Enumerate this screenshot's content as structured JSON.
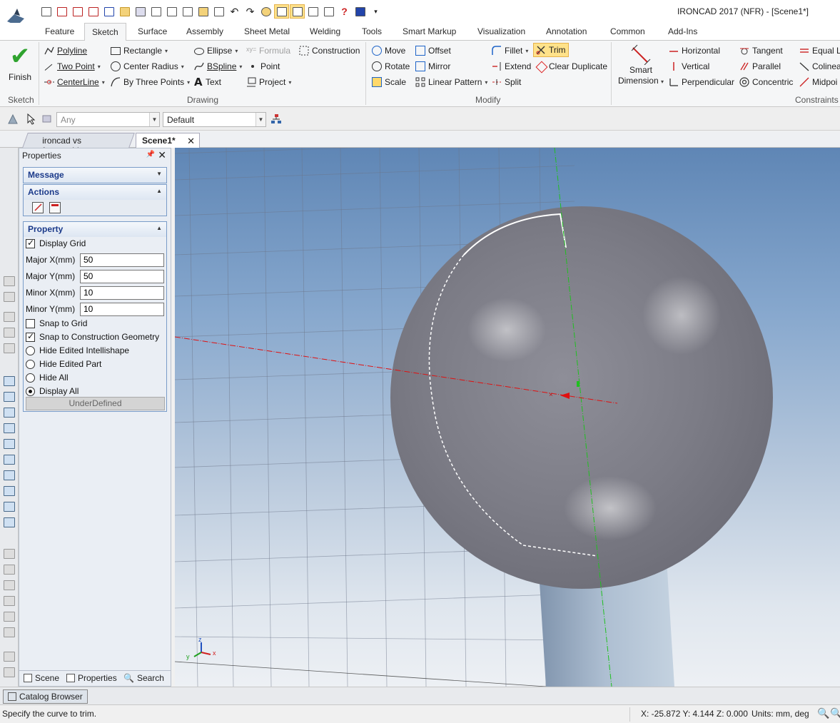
{
  "window": {
    "title": "IRONCAD 2017 (NFR) - [Scene1*]"
  },
  "ribbon_tabs": [
    "Feature",
    "Sketch",
    "Surface",
    "Assembly",
    "Sheet Metal",
    "Welding",
    "Tools",
    "Smart Markup",
    "Visualization",
    "Annotation",
    "Common",
    "Add-Ins"
  ],
  "active_tab": "Sketch",
  "ribbon": {
    "finish": "Finish",
    "groups": {
      "sketch": "Sketch",
      "drawing": "Drawing",
      "modify": "Modify",
      "constraints": "Constraints"
    },
    "drawing": {
      "polyline": "Polyline",
      "rectangle": "Rectangle",
      "ellipse": "Ellipse",
      "formula": "Formula",
      "construction": "Construction",
      "two_point": "Two Point",
      "center_radius": "Center Radius",
      "bspline": "BSpline",
      "point": "Point",
      "centerline": "CenterLine",
      "by_three_points": "By Three Points",
      "text": "Text",
      "project": "Project"
    },
    "modify": {
      "move": "Move",
      "offset": "Offset",
      "fillet": "Fillet",
      "trim": "Trim",
      "rotate": "Rotate",
      "mirror": "Mirror",
      "extend": "Extend",
      "clear_duplicate": "Clear Duplicate",
      "scale": "Scale",
      "linear_pattern": "Linear Pattern",
      "split": "Split"
    },
    "smart_dimension": {
      "line1": "Smart",
      "line2": "Dimension"
    },
    "constraints": {
      "horizontal": "Horizontal",
      "tangent": "Tangent",
      "equal": "Equal L",
      "vertical": "Vertical",
      "parallel": "Parallel",
      "colinear": "Colinea",
      "perpendicular": "Perpendicular",
      "concentric": "Concentric",
      "midpoint": "Midpoi"
    }
  },
  "toolbar": {
    "filter_value": "Any",
    "layer_value": "Default"
  },
  "doc_tabs": [
    {
      "label": "ironcad vs f...ssembly"
    },
    {
      "label": "Scene1*"
    }
  ],
  "properties": {
    "title": "Properties",
    "message": "Message",
    "actions": "Actions",
    "property": "Property",
    "display_grid": "Display Grid",
    "major_x_label": "Major X(mm)",
    "major_x": "50",
    "major_y_label": "Major Y(mm)",
    "major_y": "50",
    "minor_x_label": "Minor X(mm)",
    "minor_x": "10",
    "minor_y_label": "Minor Y(mm)",
    "minor_y": "10",
    "snap_to_grid": "Snap to Grid",
    "snap_to_construction": "Snap to Construction Geometry",
    "hide_edited_intellishape": "Hide Edited Intellishape",
    "hide_edited_part": "Hide Edited Part",
    "hide_all": "Hide All",
    "display_all": "Display All",
    "underdefined": "UnderDefined",
    "tabs": {
      "scene": "Scene",
      "properties": "Properties",
      "search": "Search"
    }
  },
  "triad": {
    "x": "x",
    "y": "y",
    "z": "z"
  },
  "catalog_browser": "Catalog Browser",
  "status": {
    "prompt": "Specify the curve to trim.",
    "coords": "X: -25.872 Y: 4.144 Z: 0.000",
    "units": "Units: mm, deg"
  },
  "colors": {
    "accent": "#1e64c8",
    "highlight": "#ffe28a",
    "finish_green": "#2fa32f",
    "axis_x": "#e01010",
    "axis_y": "#20c020"
  }
}
